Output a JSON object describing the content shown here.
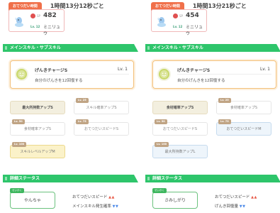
{
  "left": {
    "helper_tag": "おてつだい時間",
    "helper_time": "1時間13分12秒ごと",
    "pokemon": {
      "sp_label": "SP",
      "sp": "482",
      "level": "Lv. 12",
      "name": "ミニリュウ"
    },
    "section_main": "メインスキル・サブスキル",
    "main_skill": {
      "name": "げんきチャージS",
      "level": "Lv. 1",
      "description": "自分のげんきを12回復する"
    },
    "sub_skills": [
      {
        "lv": "",
        "label": "最大所持数アップS",
        "style": "gold"
      },
      {
        "lv": "Lv. 25",
        "label": "スキル確率アップS",
        "style": "plain"
      },
      {
        "lv": "Lv. 50",
        "label": "食材確率アップS",
        "style": "plain"
      },
      {
        "lv": "Lv. 75",
        "label": "おてつだいスピードS",
        "style": "plain"
      },
      {
        "lv": "Lv. 100",
        "label": "スキルレベルアップM",
        "style": "yellow"
      }
    ],
    "section_detail": "詳細ステータス",
    "nature": {
      "tag": "せいかく",
      "name": "やんちゃ"
    },
    "effects": [
      {
        "label": "おてつだいスピード",
        "arrows": "▲▲",
        "dir": "up"
      },
      {
        "label": "メインスキル発生確率",
        "arrows": "▼▼",
        "dir": "down"
      }
    ]
  },
  "right": {
    "helper_tag": "おてつだい時間",
    "helper_time": "1時間13分21秒ごと",
    "pokemon": {
      "sp_label": "SP",
      "sp": "454",
      "level": "Lv. 12",
      "name": "ミニリュウ"
    },
    "section_main": "メインスキル・サブスキル",
    "main_skill": {
      "name": "げんきチャージS",
      "level": "Lv. 1",
      "description": "自分のげんきを12回復する"
    },
    "sub_skills": [
      {
        "lv": "",
        "label": "食材確率アップS",
        "style": "gold"
      },
      {
        "lv": "Lv. 25",
        "label": "食材確率アップS",
        "style": "plain"
      },
      {
        "lv": "Lv. 50",
        "label": "おてつだいスピードS",
        "style": "plain"
      },
      {
        "lv": "Lv. 75",
        "label": "おてつだいスピードM",
        "style": "blue"
      },
      {
        "lv": "Lv. 100",
        "label": "最大所持数アップL",
        "style": "blue"
      }
    ],
    "section_detail": "詳細ステータス",
    "nature": {
      "tag": "せいかく",
      "name": "さみしがり"
    },
    "effects": [
      {
        "label": "おてつだいスピード",
        "arrows": "▲▲",
        "dir": "up"
      },
      {
        "label": "げんき回復量",
        "arrows": "▼▼",
        "dir": "down"
      }
    ]
  },
  "colors": {
    "accent_green": "#2ec56b",
    "helper_orange": "#f0704a",
    "skill_border": "#f3c07a"
  },
  "icons": {
    "pokemon": "dratini-sprite-icon",
    "skill": "energy-face-icon",
    "sp": "sp-ball-icon"
  }
}
